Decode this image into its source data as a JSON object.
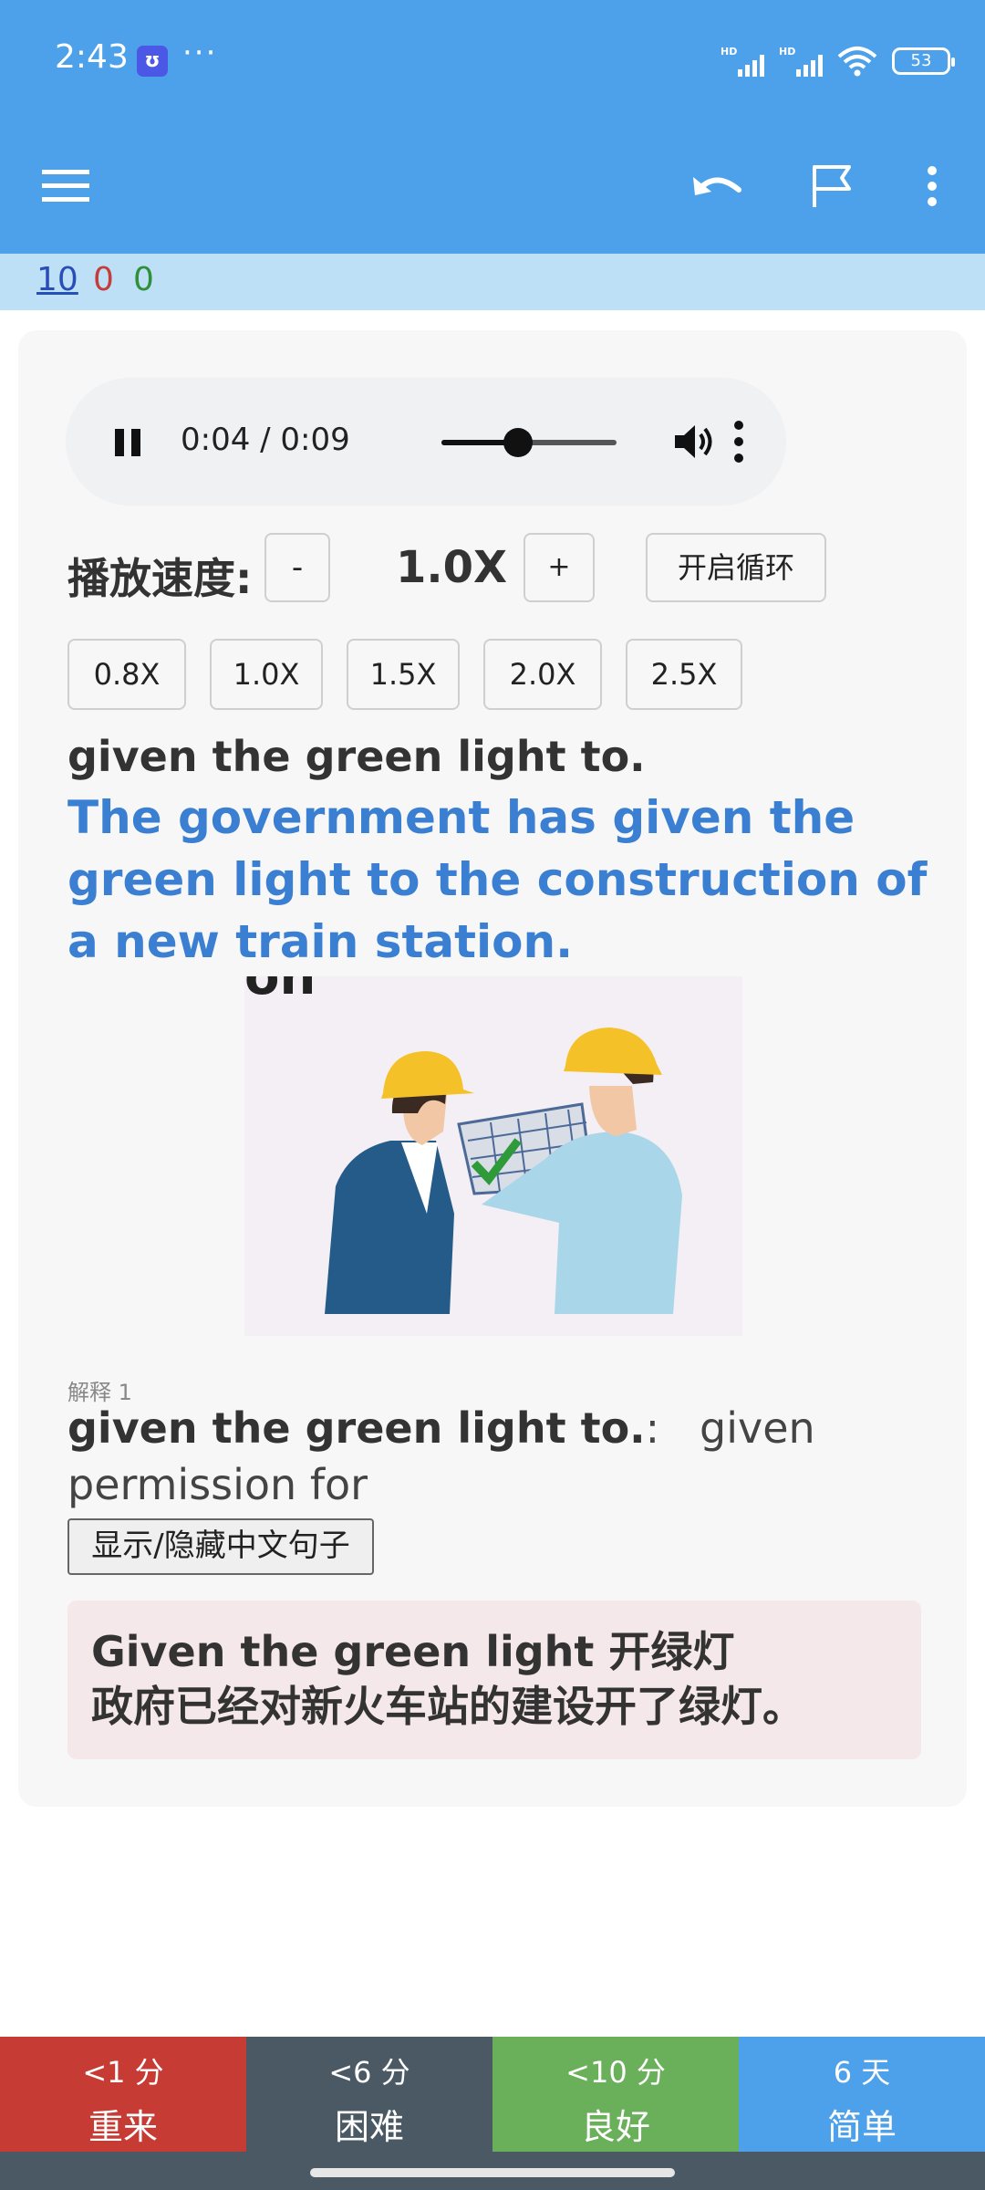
{
  "status_bar": {
    "time": "2:43",
    "app_icon_letter": "ʊ",
    "dots": "···",
    "battery": "53",
    "hd1": "HD",
    "hd2": "HD"
  },
  "toolbar": {
    "menu_icon": "hamburger-menu-icon",
    "undo_icon": "undo-icon",
    "flag_icon": "flag-icon",
    "more_icon": "more-vertical-icon"
  },
  "counts": {
    "new": "10",
    "learning": "0",
    "review": "0"
  },
  "audio": {
    "time": "0:04 / 0:09",
    "progress": 0.44
  },
  "speed": {
    "label": "播放速度:",
    "minus": "-",
    "value": "1.0X",
    "plus": "+",
    "loop": "开启循环",
    "presets": [
      "0.8X",
      "1.0X",
      "1.5X",
      "2.0X",
      "2.5X"
    ]
  },
  "card": {
    "term": "given the green light to.",
    "example": "The government has given the green light to the construction of a new train station.",
    "illustration_caption": "on",
    "definition_label": "解释 1",
    "definition_term": "given the green light to.",
    "definition_sep": ":",
    "definition_text": "given permission for",
    "toggle_button": "显示/隐藏中文句子",
    "chinese_line1": "Given the green light 开绿灯",
    "chinese_line2": "政府已经对新火车站的建设开了绿灯。"
  },
  "answers": [
    {
      "interval": "<1 分",
      "label": "重来"
    },
    {
      "interval": "<6 分",
      "label": "困难"
    },
    {
      "interval": "<10 分",
      "label": "良好"
    },
    {
      "interval": "6 天",
      "label": "简单"
    }
  ],
  "colors": {
    "header": "#4ca1ea",
    "counts_bar": "#bde0f6",
    "example_text": "#3a7fd1",
    "again": "#c73b35",
    "hard": "#4a5964",
    "good": "#6ab05a",
    "easy": "#4ca1ea"
  }
}
